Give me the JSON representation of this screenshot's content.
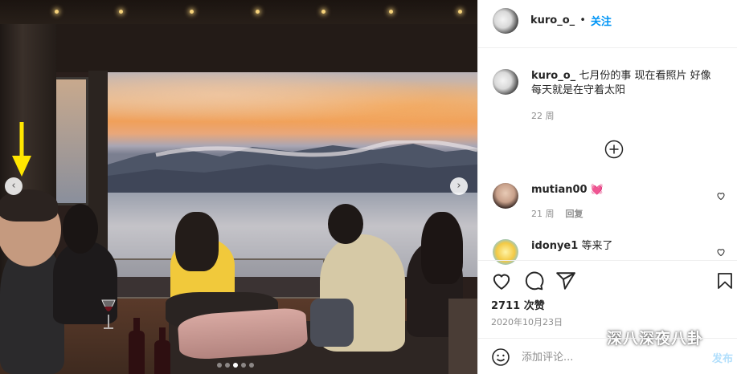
{
  "post": {
    "username": "kuro_o_",
    "separator": "•",
    "follow_label": "关注",
    "caption_user": "kuro_o_",
    "caption_line1": "七月份的事 现在看照片 好像",
    "caption_line2": "每天就是在守着太阳",
    "caption_age": "22 周"
  },
  "comments": [
    {
      "user": "mutian00",
      "text": "💓",
      "age": "21 周",
      "reply_label": "回复"
    },
    {
      "user": "idonye1",
      "text": "等来了"
    }
  ],
  "actions": {
    "likes": "2711 次赞",
    "date": "2020年10月23日"
  },
  "comment_box": {
    "placeholder": "添加评论...",
    "post_label": "发布"
  },
  "watermark": "深八深夜八卦",
  "carousel": {
    "prev": "‹",
    "next": "›",
    "slide_count": 5,
    "active_slide": 3
  },
  "colors": {
    "accent": "#0095f6",
    "heart": "#ff3c8e",
    "annotation_arrow": "#ffe600"
  }
}
